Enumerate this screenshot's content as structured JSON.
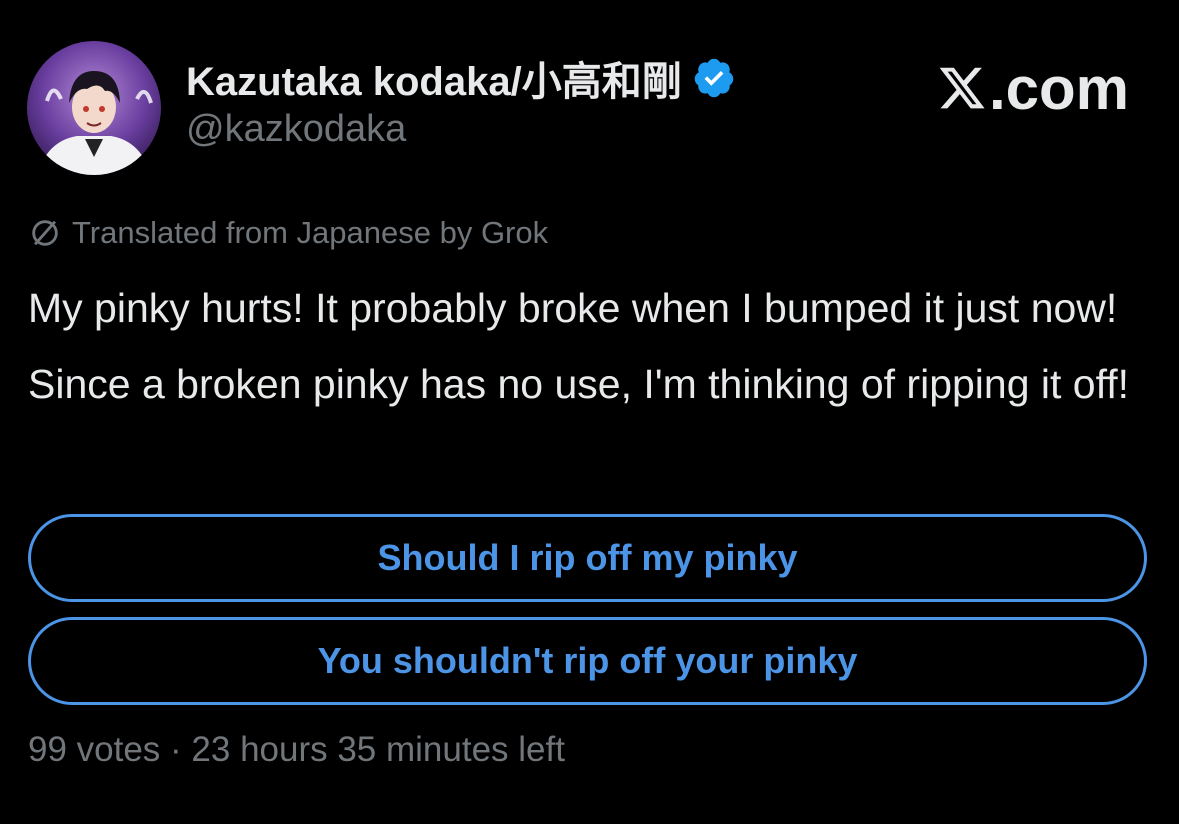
{
  "author": {
    "name": "Kazutaka kodaka/小高和剛",
    "handle": "@kazkodaka",
    "verified_icon": "verified-badge-icon",
    "avatar_icon": "avatar-image"
  },
  "brand": {
    "label": ".com",
    "logo_icon": "x-logo-icon"
  },
  "translation": {
    "icon": "globe-icon",
    "label": "Translated from Japanese by Grok"
  },
  "tweet": {
    "text": "My pinky hurts! It probably broke when I bumped it just now! Since a broken pinky has no use, I'm thinking of ripping it off!"
  },
  "poll": {
    "options": [
      {
        "label": "Should I rip off my pinky"
      },
      {
        "label": "You shouldn't rip off your pinky"
      }
    ],
    "meta": "99 votes · 23 hours 35 minutes left"
  },
  "colors": {
    "background": "#000000",
    "text": "#e7e9ea",
    "muted": "#71767b",
    "accent": "#4b94e6",
    "verified": "#1d9bf0"
  }
}
